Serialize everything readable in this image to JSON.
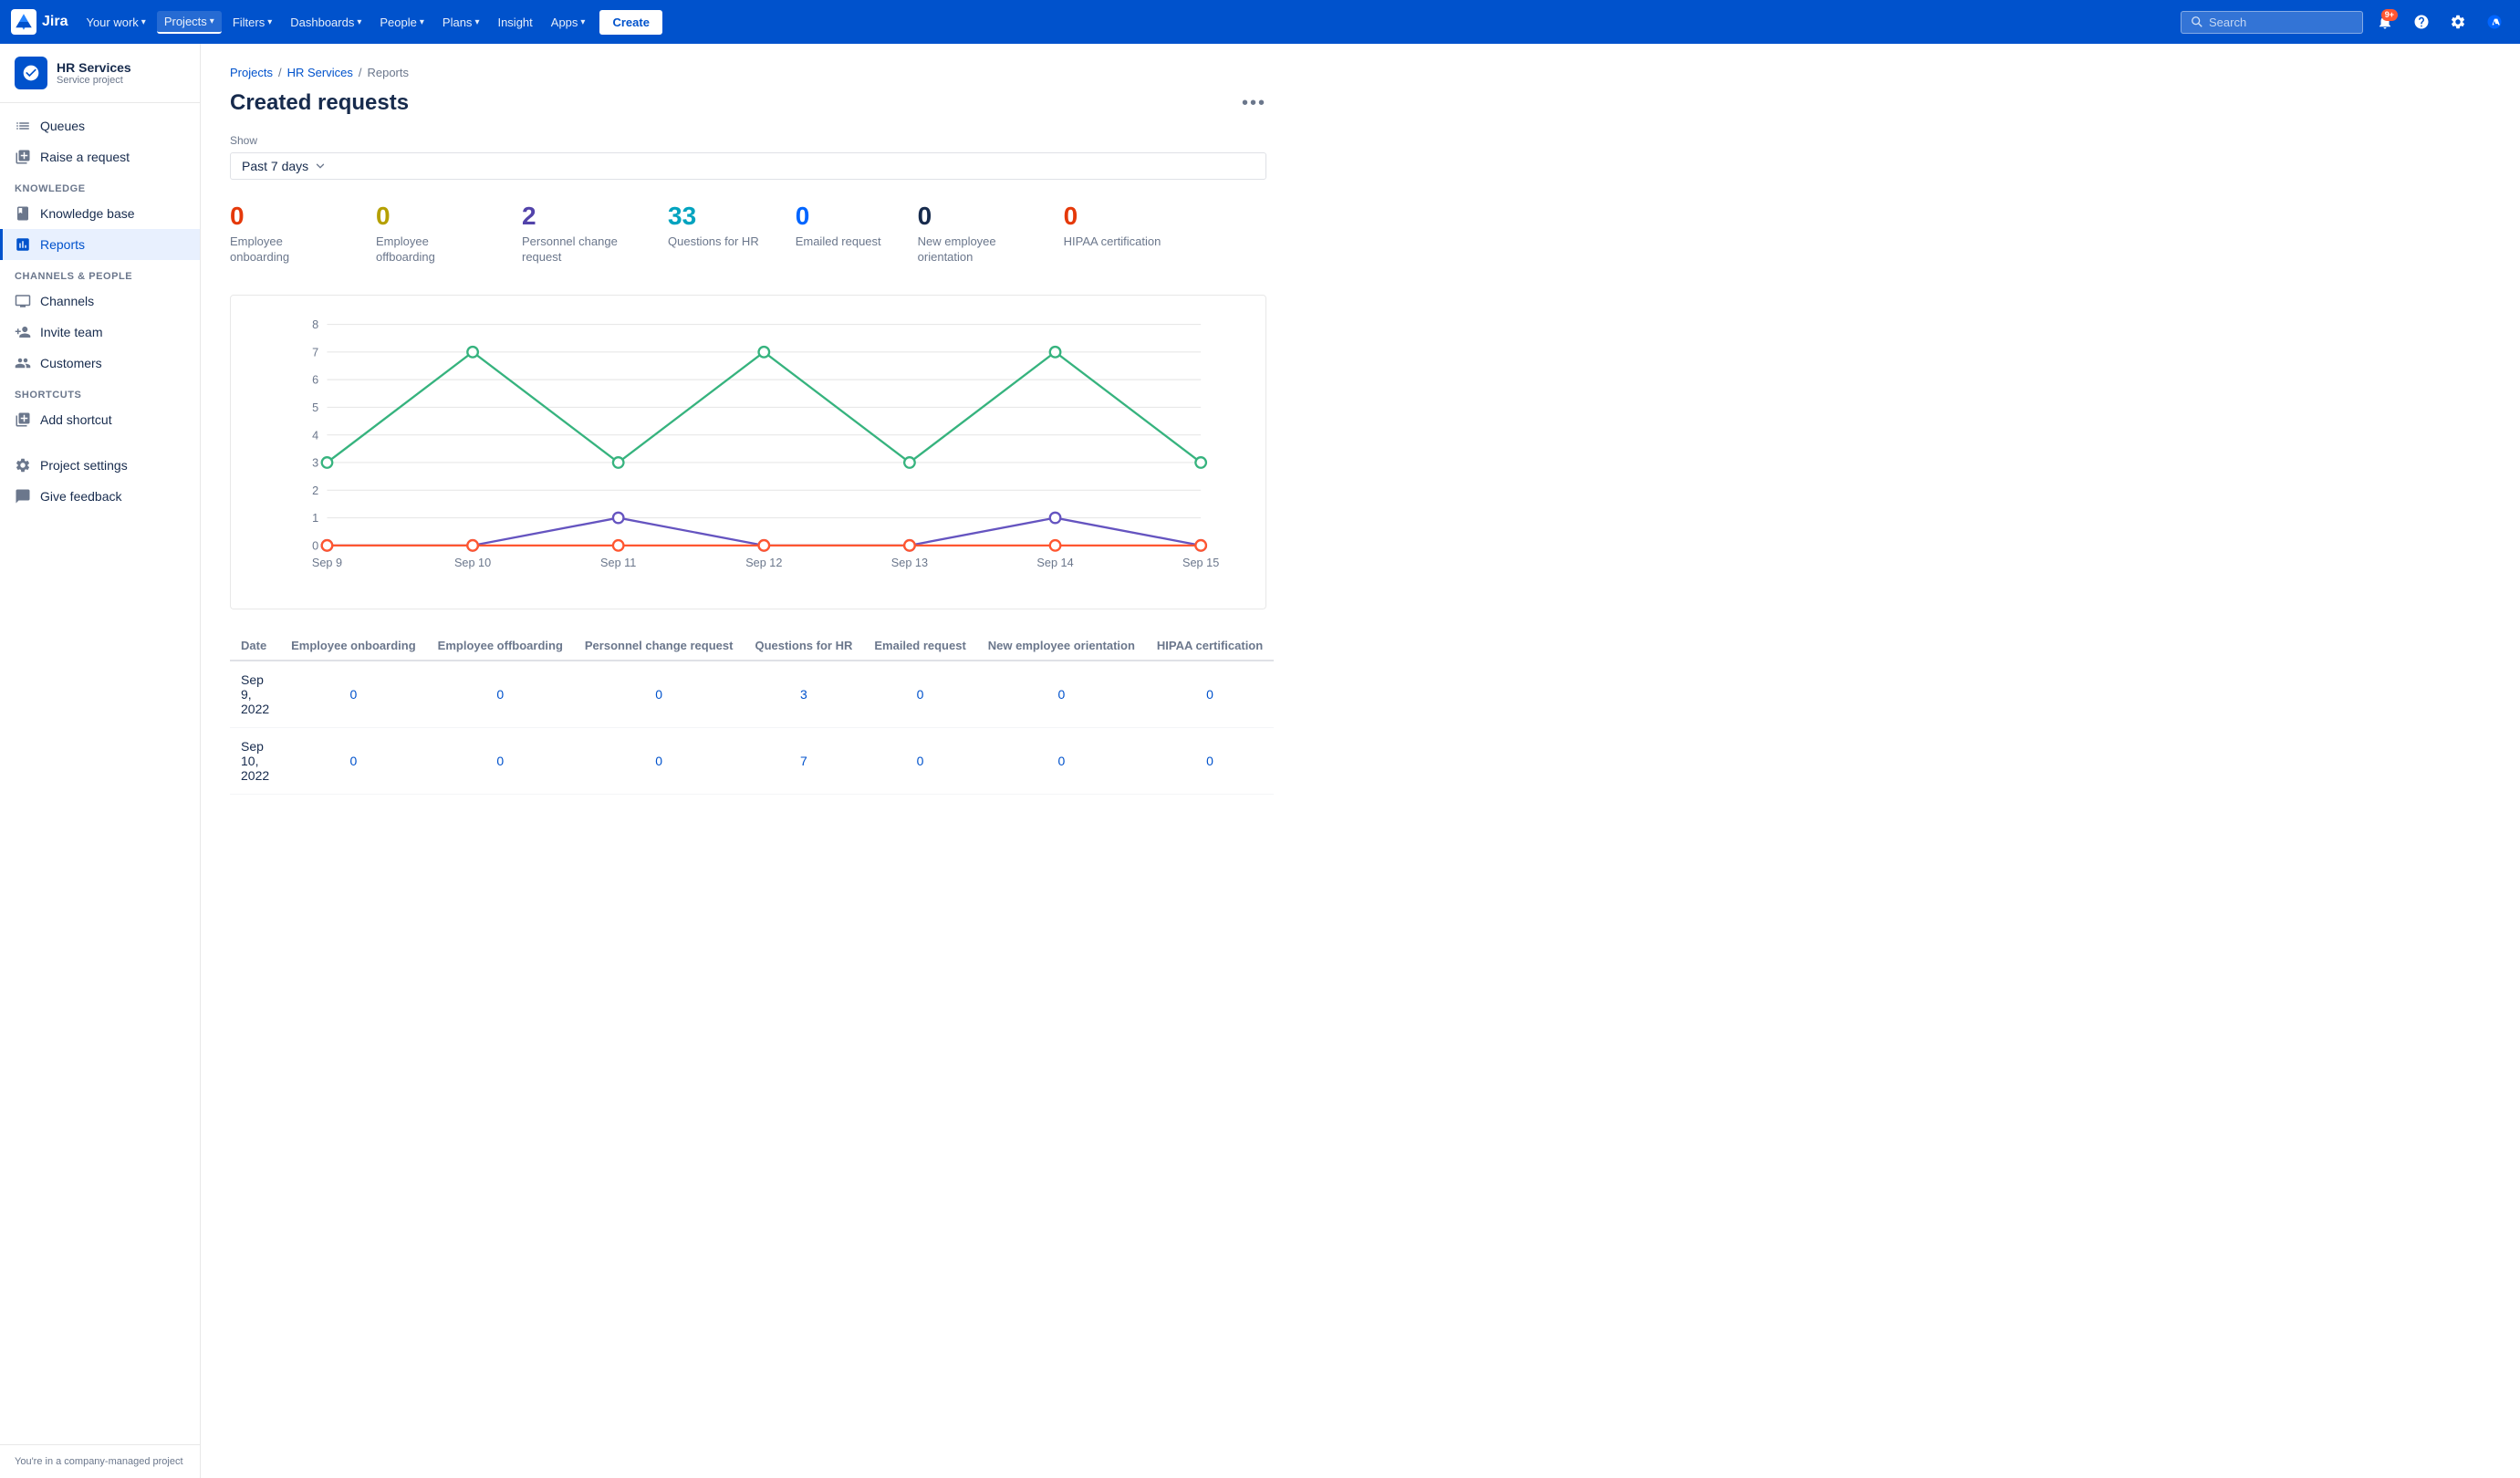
{
  "topnav": {
    "logo_text": "Jira",
    "nav_items": [
      {
        "label": "Your work",
        "has_caret": true
      },
      {
        "label": "Projects",
        "has_caret": true,
        "active": true
      },
      {
        "label": "Filters",
        "has_caret": true
      },
      {
        "label": "Dashboards",
        "has_caret": true
      },
      {
        "label": "People",
        "has_caret": true
      },
      {
        "label": "Plans",
        "has_caret": true
      },
      {
        "label": "Insight",
        "has_caret": false
      },
      {
        "label": "Apps",
        "has_caret": true
      }
    ],
    "create_label": "Create",
    "search_placeholder": "Search",
    "notification_badge": "9+"
  },
  "sidebar": {
    "project_name": "HR Services",
    "project_type": "Service project",
    "nav_items": [
      {
        "label": "Queues",
        "icon": "queues",
        "active": false
      },
      {
        "label": "Raise a request",
        "icon": "raise",
        "active": false
      }
    ],
    "knowledge_section": "KNOWLEDGE",
    "knowledge_items": [
      {
        "label": "Knowledge base",
        "icon": "knowledge",
        "active": false
      },
      {
        "label": "Reports",
        "icon": "reports",
        "active": true
      }
    ],
    "channels_section": "CHANNELS & PEOPLE",
    "channels_items": [
      {
        "label": "Channels",
        "icon": "channels",
        "active": false
      },
      {
        "label": "Invite team",
        "icon": "invite",
        "active": false
      },
      {
        "label": "Customers",
        "icon": "customers",
        "active": false
      }
    ],
    "shortcuts_section": "SHORTCUTS",
    "shortcuts_items": [
      {
        "label": "Add shortcut",
        "icon": "add-shortcut",
        "active": false
      }
    ],
    "bottom_items": [
      {
        "label": "Project settings",
        "icon": "settings"
      },
      {
        "label": "Give feedback",
        "icon": "feedback"
      }
    ],
    "footer_text": "You're in a company-managed project"
  },
  "breadcrumb": {
    "items": [
      {
        "label": "Projects",
        "link": true
      },
      {
        "label": "HR Services",
        "link": true
      },
      {
        "label": "Reports",
        "link": false
      }
    ]
  },
  "page": {
    "title": "Created requests",
    "show_label": "Show",
    "filter_value": "Past 7 days"
  },
  "stats": [
    {
      "value": "0",
      "label": "Employee onboarding",
      "color": "#e5390a"
    },
    {
      "value": "0",
      "label": "Employee offboarding",
      "color": "#b5a000"
    },
    {
      "value": "2",
      "label": "Personnel change request",
      "color": "#5243aa"
    },
    {
      "value": "33",
      "label": "Questions for HR",
      "color": "#00a3bf"
    },
    {
      "value": "0",
      "label": "Emailed request",
      "color": "#0065ff"
    },
    {
      "value": "0",
      "label": "New employee orientation",
      "color": "#172b4d"
    },
    {
      "value": "0",
      "label": "HIPAA certification",
      "color": "#e5390a"
    }
  ],
  "chart": {
    "y_labels": [
      "0",
      "1",
      "2",
      "3",
      "4",
      "5",
      "6",
      "7",
      "8"
    ],
    "x_labels": [
      "Sep 9",
      "Sep 10",
      "Sep 11",
      "Sep 12",
      "Sep 13",
      "Sep 14",
      "Sep 15"
    ],
    "green_series": [
      3,
      7,
      3,
      7,
      3,
      7,
      3
    ],
    "purple_series": [
      0,
      0,
      1,
      0,
      0,
      1,
      0
    ],
    "red_series": [
      0,
      0,
      0,
      0,
      0,
      0,
      0
    ]
  },
  "table": {
    "columns": [
      "Date",
      "Employee onboarding",
      "Employee offboarding",
      "Personnel change request",
      "Questions for HR",
      "Emailed request",
      "New employee orientation",
      "HIPAA certification"
    ],
    "rows": [
      {
        "date": "Sep 9, 2022",
        "values": [
          "0",
          "0",
          "0",
          "3",
          "0",
          "0",
          "0"
        ]
      },
      {
        "date": "Sep 10, 2022",
        "values": [
          "0",
          "0",
          "0",
          "7",
          "0",
          "0",
          "0"
        ]
      }
    ]
  }
}
